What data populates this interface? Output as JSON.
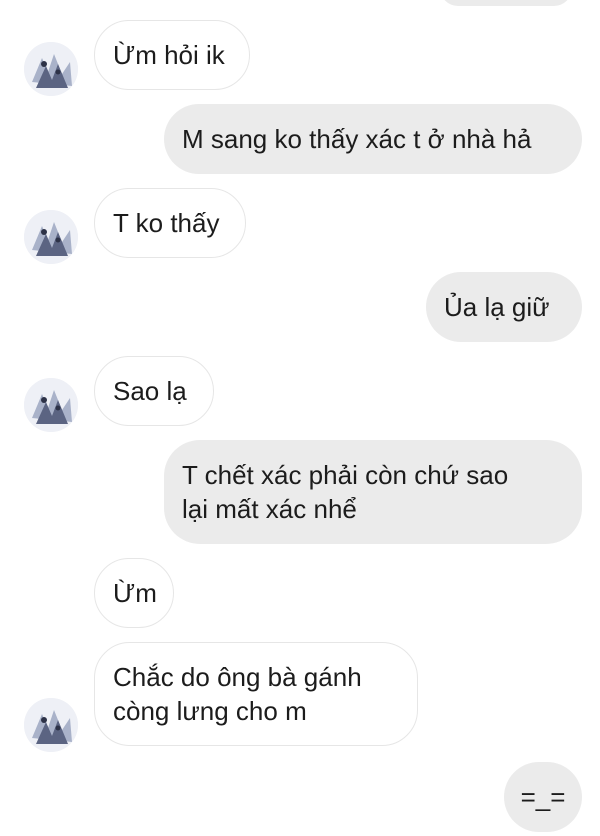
{
  "messages": [
    {
      "text": "Ừm hỏi ik",
      "side": "in"
    },
    {
      "text": "M sang ko thấy xác t ở nhà hả",
      "side": "out"
    },
    {
      "text": "T ko thấy",
      "side": "in"
    },
    {
      "text": "Ủa lạ giữ",
      "side": "out"
    },
    {
      "text": "Sao lạ",
      "side": "in"
    },
    {
      "text": "T chết xác phải còn chứ sao\nlại mất xác nhể",
      "side": "out"
    },
    {
      "text": "Ừm",
      "side": "in"
    },
    {
      "text": "Chắc do ông bà gánh\ncòng lưng cho m",
      "side": "in"
    },
    {
      "text": "=_=",
      "side": "out"
    }
  ],
  "colors": {
    "incoming_bg": "#ffffff",
    "incoming_border": "#e6e6e6",
    "outgoing_bg": "#ebebeb",
    "text": "#1c1c1c"
  },
  "avatar_icon": "anime-profile-picture"
}
